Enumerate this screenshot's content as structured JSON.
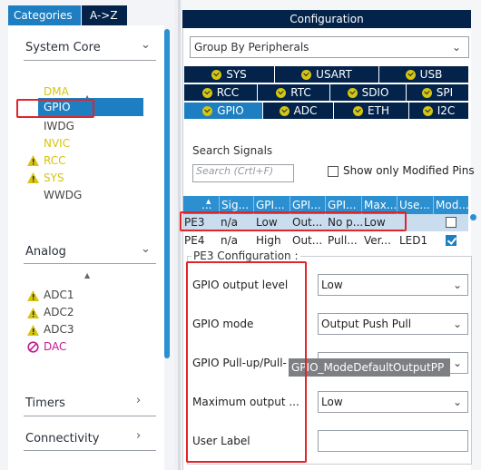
{
  "left_pane": {
    "tabs": [
      "Categories",
      "A->Z"
    ],
    "categories": {
      "system_core": "System Core",
      "analog": "Analog",
      "timers": "Timers",
      "connectivity": "Connectivity"
    },
    "system_core_items": [
      "DMA",
      "GPIO",
      "IWDG",
      "NVIC",
      "RCC",
      "SYS",
      "WWDG"
    ],
    "analog_items": [
      "ADC1",
      "ADC2",
      "ADC3",
      "DAC"
    ]
  },
  "configuration": {
    "title": "Configuration",
    "group_by": "Group By Peripherals",
    "peripheral_tabs": {
      "row1": [
        "SYS",
        "USART",
        "USB"
      ],
      "row2": [
        "RCC",
        "RTC",
        "SDIO",
        "SPI"
      ],
      "row3": [
        "GPIO",
        "ADC",
        "ETH",
        "I2C"
      ],
      "active": "GPIO"
    },
    "search": {
      "title": "Search Signals",
      "placeholder": "Search (Crtl+F)",
      "show_modified_label": "Show only Modified Pins"
    },
    "table": {
      "headers": [
        "...",
        "Sig...",
        "GPI...",
        "GPI...",
        "GPI...",
        "Max...",
        "Use...",
        "Mod..."
      ],
      "rows": [
        {
          "pin": "PE3",
          "signal": "n/a",
          "output_level": "Low",
          "mode": "Out...",
          "pull": "No p...",
          "speed": "Low",
          "label": "",
          "modified": false
        },
        {
          "pin": "PE4",
          "signal": "n/a",
          "output_level": "High",
          "mode": "Out...",
          "pull": "Pull...",
          "speed": "Ver...",
          "label": "LED1",
          "modified": true
        }
      ]
    },
    "pin_config": {
      "title": "PE3 Configuration :",
      "fields": [
        {
          "label": "GPIO output level",
          "value": "Low"
        },
        {
          "label": "GPIO mode",
          "value": "Output Push Pull"
        },
        {
          "label": "GPIO Pull-up/Pull-",
          "value": ""
        },
        {
          "label": "Maximum output ...",
          "value": "Low"
        },
        {
          "label": "User Label",
          "value": ""
        }
      ],
      "tooltip": "GPIO_ModeDefaultOutputPP"
    }
  },
  "colors": {
    "accent": "#1d7fc1",
    "dark_navy": "#03234b",
    "warning": "#d6c411",
    "highlight_box": "#e0252b"
  }
}
